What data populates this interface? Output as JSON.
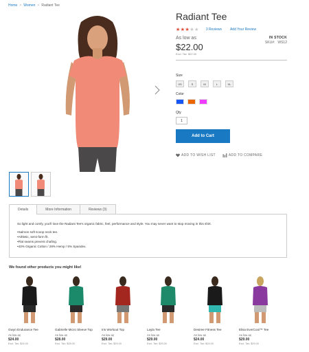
{
  "breadcrumb": {
    "home": "Home",
    "sep1": ">",
    "women": "Women",
    "sep2": ">",
    "current": "Radiant Tee"
  },
  "product": {
    "title": "Radiant Tee",
    "rating_percent": 60,
    "stars": "★★★★★",
    "reviews": "3  Reviews",
    "add_review": "Add Your Review",
    "stock": "IN STOCK",
    "sku_label": "SKU#:",
    "sku": "WS12",
    "as_low_as": "As low as",
    "price": "$22.00",
    "excl_label": "Excl. Tax",
    "excl_price": "$22.00"
  },
  "options": {
    "size_label": "Size",
    "sizes": [
      "XS",
      "S",
      "M",
      "L",
      "XL"
    ],
    "color_label": "Color",
    "colors": [
      "#1857f7",
      "#eb6703",
      "#ef3dff"
    ],
    "qty_label": "Qty",
    "qty": "1",
    "add_to_cart": "Add to Cart",
    "wishlist": "ADD TO WISH LIST",
    "compare": "ADD TO COMPARE"
  },
  "tabs": {
    "items": [
      "Details",
      "More Information",
      "Reviews (3)"
    ],
    "description": "So light and comfy, you'll love the Radiant Tee's organic fabric, feel, performance and style. You may never want to stop moving in this shirt.",
    "bullets": [
      "Salmon soft scoop neck tee.",
      "Athletic, semi-form fit.",
      "Flat seams prevent chafing.",
      "43% Organic Cotton / 28% Hemp / 5% Spandex."
    ]
  },
  "related": {
    "title": "We found other products you might like!",
    "items": [
      {
        "name": "Gwyn Endurance Tee",
        "aslow": "As low as",
        "price": "$24.00",
        "excl": "Excl. Tax: $24.00",
        "top": "#1a1a1a",
        "bottom": "#2a2a2a"
      },
      {
        "name": "Gabrielle Micro Sleeve Top",
        "aslow": "As low as",
        "price": "$28.00",
        "excl": "Excl. Tax: $28.00",
        "top": "#1a8a6a",
        "bottom": "#2a2a2a"
      },
      {
        "name": "Iris Workout Top",
        "aslow": "As low as",
        "price": "$29.00",
        "excl": "Excl. Tax: $29.00",
        "top": "#a3261f",
        "bottom": "#777777"
      },
      {
        "name": "Layla Tee",
        "aslow": "As low as",
        "price": "$29.00",
        "excl": "Excl. Tax: $29.00",
        "top": "#1f8a6a",
        "bottom": "#2a2a2a"
      },
      {
        "name": "Desiree Fitness Tee",
        "aslow": "As low as",
        "price": "$24.00",
        "excl": "Excl. Tax: $24.00",
        "top": "#1a1a1a",
        "bottom": "#2fb7b0"
      },
      {
        "name": "Elisa EverCool™ Tee",
        "aslow": "As low as",
        "price": "$29.00",
        "excl": "Excl. Tax: $29.00",
        "top": "#8a3a9e",
        "bottom": "#bcbcbc"
      }
    ]
  }
}
